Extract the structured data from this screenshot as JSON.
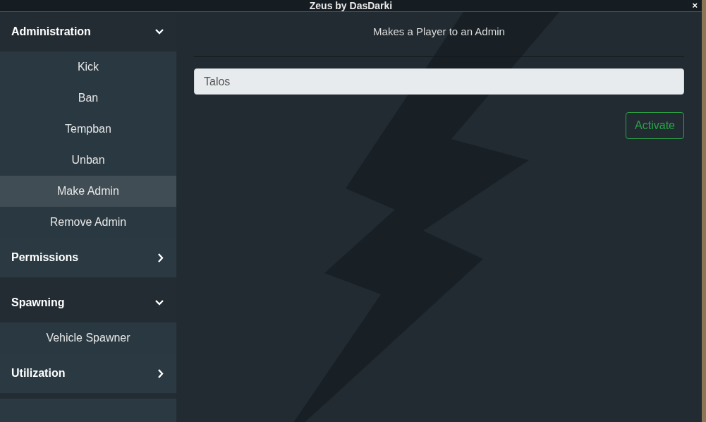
{
  "window": {
    "title": "Zeus by DasDarki",
    "close": "×"
  },
  "sidebar": {
    "sections": [
      {
        "label": "Administration",
        "expanded": true,
        "items": [
          {
            "label": "Kick",
            "selected": false
          },
          {
            "label": "Ban",
            "selected": false
          },
          {
            "label": "Tempban",
            "selected": false
          },
          {
            "label": "Unban",
            "selected": false
          },
          {
            "label": "Make Admin",
            "selected": true
          },
          {
            "label": "Remove Admin",
            "selected": false
          }
        ]
      },
      {
        "label": "Permissions",
        "expanded": false
      },
      {
        "label": "Spawning",
        "expanded": true,
        "items": [
          {
            "label": "Vehicle Spawner",
            "selected": false
          }
        ]
      },
      {
        "label": "Utilization",
        "expanded": false
      }
    ]
  },
  "main": {
    "description": "Makes a Player to an Admin",
    "input": {
      "value": "Talos"
    },
    "button": "Activate"
  }
}
